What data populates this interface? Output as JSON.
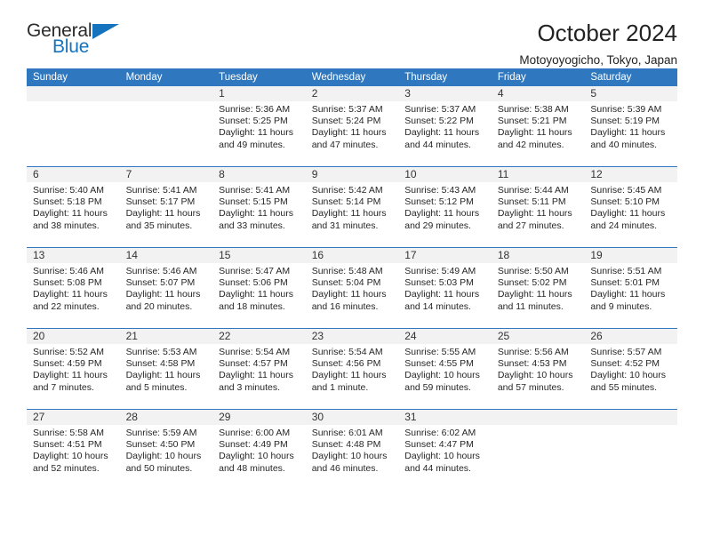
{
  "brand": {
    "name_top": "General",
    "name_bottom": "Blue"
  },
  "header": {
    "title": "October 2024",
    "subtitle": "Motoyoyogicho, Tokyo, Japan"
  },
  "colors": {
    "header_blue": "#2f78bf",
    "brand_blue": "#1673bd",
    "daynum_bg": "#f2f2f2"
  },
  "weekday_headers": [
    "Sunday",
    "Monday",
    "Tuesday",
    "Wednesday",
    "Thursday",
    "Friday",
    "Saturday"
  ],
  "weeks": [
    [
      {
        "day": "",
        "sunrise": "",
        "sunset": "",
        "daylight": "",
        "blank": true
      },
      {
        "day": "",
        "sunrise": "",
        "sunset": "",
        "daylight": "",
        "blank": true
      },
      {
        "day": "1",
        "sunrise": "Sunrise: 5:36 AM",
        "sunset": "Sunset: 5:25 PM",
        "daylight": "Daylight: 11 hours and 49 minutes."
      },
      {
        "day": "2",
        "sunrise": "Sunrise: 5:37 AM",
        "sunset": "Sunset: 5:24 PM",
        "daylight": "Daylight: 11 hours and 47 minutes."
      },
      {
        "day": "3",
        "sunrise": "Sunrise: 5:37 AM",
        "sunset": "Sunset: 5:22 PM",
        "daylight": "Daylight: 11 hours and 44 minutes."
      },
      {
        "day": "4",
        "sunrise": "Sunrise: 5:38 AM",
        "sunset": "Sunset: 5:21 PM",
        "daylight": "Daylight: 11 hours and 42 minutes."
      },
      {
        "day": "5",
        "sunrise": "Sunrise: 5:39 AM",
        "sunset": "Sunset: 5:19 PM",
        "daylight": "Daylight: 11 hours and 40 minutes."
      }
    ],
    [
      {
        "day": "6",
        "sunrise": "Sunrise: 5:40 AM",
        "sunset": "Sunset: 5:18 PM",
        "daylight": "Daylight: 11 hours and 38 minutes."
      },
      {
        "day": "7",
        "sunrise": "Sunrise: 5:41 AM",
        "sunset": "Sunset: 5:17 PM",
        "daylight": "Daylight: 11 hours and 35 minutes."
      },
      {
        "day": "8",
        "sunrise": "Sunrise: 5:41 AM",
        "sunset": "Sunset: 5:15 PM",
        "daylight": "Daylight: 11 hours and 33 minutes."
      },
      {
        "day": "9",
        "sunrise": "Sunrise: 5:42 AM",
        "sunset": "Sunset: 5:14 PM",
        "daylight": "Daylight: 11 hours and 31 minutes."
      },
      {
        "day": "10",
        "sunrise": "Sunrise: 5:43 AM",
        "sunset": "Sunset: 5:12 PM",
        "daylight": "Daylight: 11 hours and 29 minutes."
      },
      {
        "day": "11",
        "sunrise": "Sunrise: 5:44 AM",
        "sunset": "Sunset: 5:11 PM",
        "daylight": "Daylight: 11 hours and 27 minutes."
      },
      {
        "day": "12",
        "sunrise": "Sunrise: 5:45 AM",
        "sunset": "Sunset: 5:10 PM",
        "daylight": "Daylight: 11 hours and 24 minutes."
      }
    ],
    [
      {
        "day": "13",
        "sunrise": "Sunrise: 5:46 AM",
        "sunset": "Sunset: 5:08 PM",
        "daylight": "Daylight: 11 hours and 22 minutes."
      },
      {
        "day": "14",
        "sunrise": "Sunrise: 5:46 AM",
        "sunset": "Sunset: 5:07 PM",
        "daylight": "Daylight: 11 hours and 20 minutes."
      },
      {
        "day": "15",
        "sunrise": "Sunrise: 5:47 AM",
        "sunset": "Sunset: 5:06 PM",
        "daylight": "Daylight: 11 hours and 18 minutes."
      },
      {
        "day": "16",
        "sunrise": "Sunrise: 5:48 AM",
        "sunset": "Sunset: 5:04 PM",
        "daylight": "Daylight: 11 hours and 16 minutes."
      },
      {
        "day": "17",
        "sunrise": "Sunrise: 5:49 AM",
        "sunset": "Sunset: 5:03 PM",
        "daylight": "Daylight: 11 hours and 14 minutes."
      },
      {
        "day": "18",
        "sunrise": "Sunrise: 5:50 AM",
        "sunset": "Sunset: 5:02 PM",
        "daylight": "Daylight: 11 hours and 11 minutes."
      },
      {
        "day": "19",
        "sunrise": "Sunrise: 5:51 AM",
        "sunset": "Sunset: 5:01 PM",
        "daylight": "Daylight: 11 hours and 9 minutes."
      }
    ],
    [
      {
        "day": "20",
        "sunrise": "Sunrise: 5:52 AM",
        "sunset": "Sunset: 4:59 PM",
        "daylight": "Daylight: 11 hours and 7 minutes."
      },
      {
        "day": "21",
        "sunrise": "Sunrise: 5:53 AM",
        "sunset": "Sunset: 4:58 PM",
        "daylight": "Daylight: 11 hours and 5 minutes."
      },
      {
        "day": "22",
        "sunrise": "Sunrise: 5:54 AM",
        "sunset": "Sunset: 4:57 PM",
        "daylight": "Daylight: 11 hours and 3 minutes."
      },
      {
        "day": "23",
        "sunrise": "Sunrise: 5:54 AM",
        "sunset": "Sunset: 4:56 PM",
        "daylight": "Daylight: 11 hours and 1 minute."
      },
      {
        "day": "24",
        "sunrise": "Sunrise: 5:55 AM",
        "sunset": "Sunset: 4:55 PM",
        "daylight": "Daylight: 10 hours and 59 minutes."
      },
      {
        "day": "25",
        "sunrise": "Sunrise: 5:56 AM",
        "sunset": "Sunset: 4:53 PM",
        "daylight": "Daylight: 10 hours and 57 minutes."
      },
      {
        "day": "26",
        "sunrise": "Sunrise: 5:57 AM",
        "sunset": "Sunset: 4:52 PM",
        "daylight": "Daylight: 10 hours and 55 minutes."
      }
    ],
    [
      {
        "day": "27",
        "sunrise": "Sunrise: 5:58 AM",
        "sunset": "Sunset: 4:51 PM",
        "daylight": "Daylight: 10 hours and 52 minutes."
      },
      {
        "day": "28",
        "sunrise": "Sunrise: 5:59 AM",
        "sunset": "Sunset: 4:50 PM",
        "daylight": "Daylight: 10 hours and 50 minutes."
      },
      {
        "day": "29",
        "sunrise": "Sunrise: 6:00 AM",
        "sunset": "Sunset: 4:49 PM",
        "daylight": "Daylight: 10 hours and 48 minutes."
      },
      {
        "day": "30",
        "sunrise": "Sunrise: 6:01 AM",
        "sunset": "Sunset: 4:48 PM",
        "daylight": "Daylight: 10 hours and 46 minutes."
      },
      {
        "day": "31",
        "sunrise": "Sunrise: 6:02 AM",
        "sunset": "Sunset: 4:47 PM",
        "daylight": "Daylight: 10 hours and 44 minutes."
      },
      {
        "day": "",
        "sunrise": "",
        "sunset": "",
        "daylight": "",
        "blank": true
      },
      {
        "day": "",
        "sunrise": "",
        "sunset": "",
        "daylight": "",
        "blank": true
      }
    ]
  ]
}
